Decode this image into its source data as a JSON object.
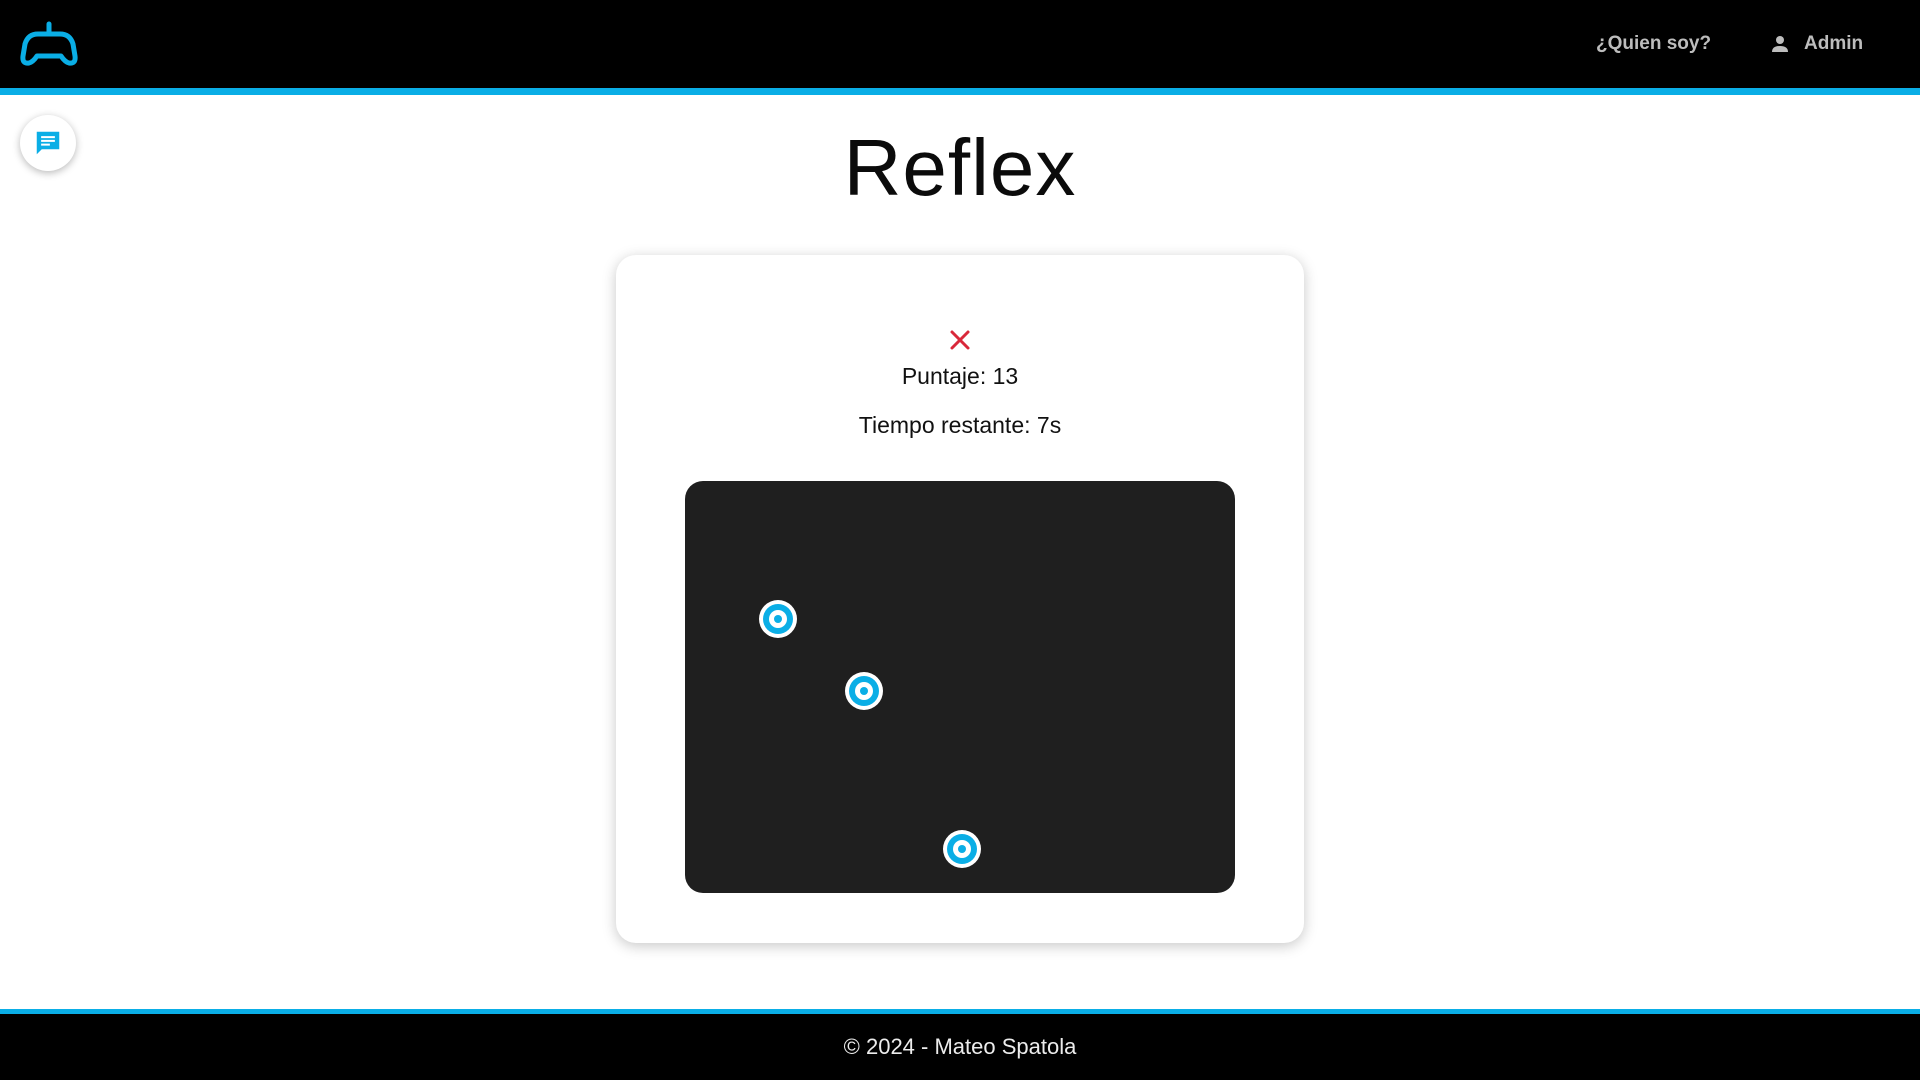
{
  "header": {
    "logo_icon": "gamepad-icon",
    "about_label": "¿Quien soy?",
    "admin_label": "Admin",
    "admin_icon": "person-icon"
  },
  "chat": {
    "icon": "chat-icon"
  },
  "page": {
    "title": "Reflex"
  },
  "game": {
    "status_icon": "close-icon",
    "score_text": "Puntaje: 13",
    "time_text": "Tiempo restante: 7s",
    "target_icon": "bullseye-target-icon",
    "target_count": 3
  },
  "footer": {
    "text": "© 2024 - Mateo Spatola"
  },
  "colors": {
    "accent": "#0aaee6",
    "bar": "#000000",
    "arena": "#1f1f1f",
    "close": "#d9283a"
  }
}
